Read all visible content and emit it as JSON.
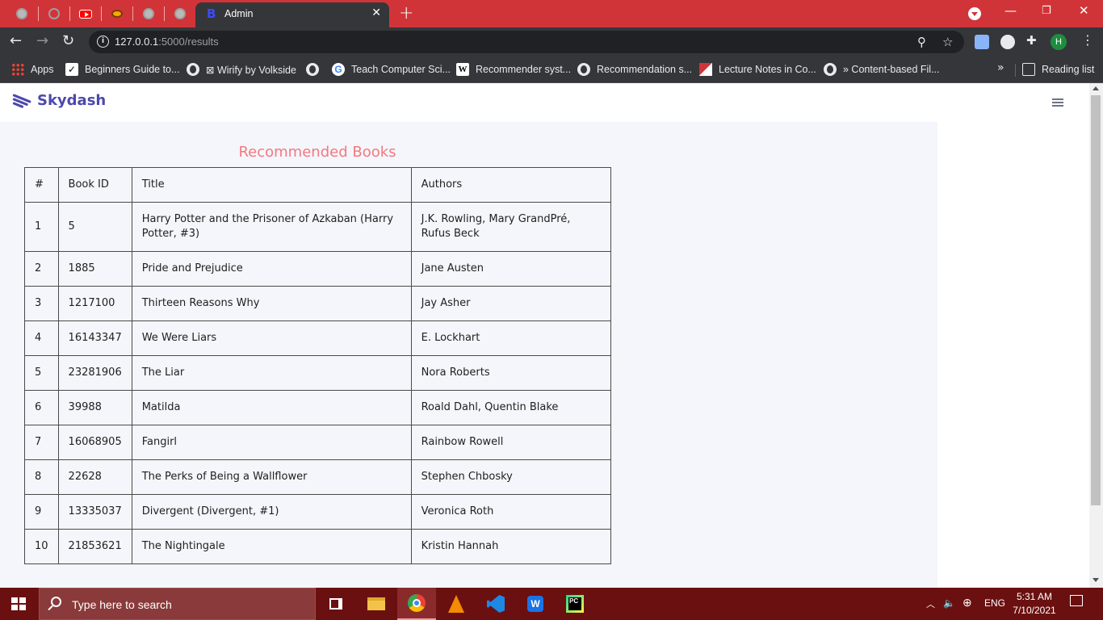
{
  "browser": {
    "active_tab_title": "Admin",
    "url_host": "127.0.0.1",
    "url_path": ":5000/results",
    "profile_initial": "H",
    "tab_icons": [
      "globe-icon",
      "blocked-icon",
      "youtube-icon",
      "eye-icon",
      "globe-icon",
      "globe-icon"
    ],
    "bookmarks": [
      {
        "label": "Apps",
        "icon": "apps-grid-icon"
      },
      {
        "label": "Beginners Guide to...",
        "icon": "check-icon"
      },
      {
        "label": "⊠ Wirify by Volkside",
        "icon": "globe-icon"
      },
      {
        "label": "",
        "icon": "globe-icon"
      },
      {
        "label": "Teach Computer Sci...",
        "icon": "google-icon"
      },
      {
        "label": "Recommender syst...",
        "icon": "wikipedia-icon"
      },
      {
        "label": "Recommendation s...",
        "icon": "globe-icon"
      },
      {
        "label": "Lecture Notes in Co...",
        "icon": "flag-icon"
      },
      {
        "label": "» Content-based Fil...",
        "icon": "globe-icon"
      }
    ],
    "bookmarks_more": "»",
    "reading_list": "Reading list"
  },
  "app": {
    "brand": "Skydash",
    "accent_color": "#4b49ac",
    "title_color": "#f3797e",
    "section_title": "Recommended Books",
    "table": {
      "headers": [
        "#",
        "Book ID",
        "Title",
        "Authors"
      ],
      "rows": [
        [
          "1",
          "5",
          "Harry Potter and the Prisoner of Azkaban (Harry Potter, #3)",
          "J.K. Rowling, Mary GrandPré, Rufus Beck"
        ],
        [
          "2",
          "1885",
          "Pride and Prejudice",
          "Jane Austen"
        ],
        [
          "3",
          "1217100",
          "Thirteen Reasons Why",
          "Jay Asher"
        ],
        [
          "4",
          "16143347",
          "We Were Liars",
          "E. Lockhart"
        ],
        [
          "5",
          "23281906",
          "The Liar",
          "Nora Roberts"
        ],
        [
          "6",
          "39988",
          "Matilda",
          "Roald Dahl, Quentin Blake"
        ],
        [
          "7",
          "16068905",
          "Fangirl",
          "Rainbow Rowell"
        ],
        [
          "8",
          "22628",
          "The Perks of Being a Wallflower",
          "Stephen Chbosky"
        ],
        [
          "9",
          "13335037",
          "Divergent (Divergent, #1)",
          "Veronica Roth"
        ],
        [
          "10",
          "21853621",
          "The Nightingale",
          "Kristin Hannah"
        ]
      ]
    }
  },
  "taskbar": {
    "search_placeholder": "Type here to search",
    "language": "ENG",
    "time": "5:31 AM",
    "date": "7/10/2021",
    "pinned": [
      "task-view-icon",
      "file-explorer-icon",
      "chrome-icon",
      "vlc-icon",
      "vscode-icon",
      "wps-icon",
      "pycharm-icon"
    ]
  }
}
